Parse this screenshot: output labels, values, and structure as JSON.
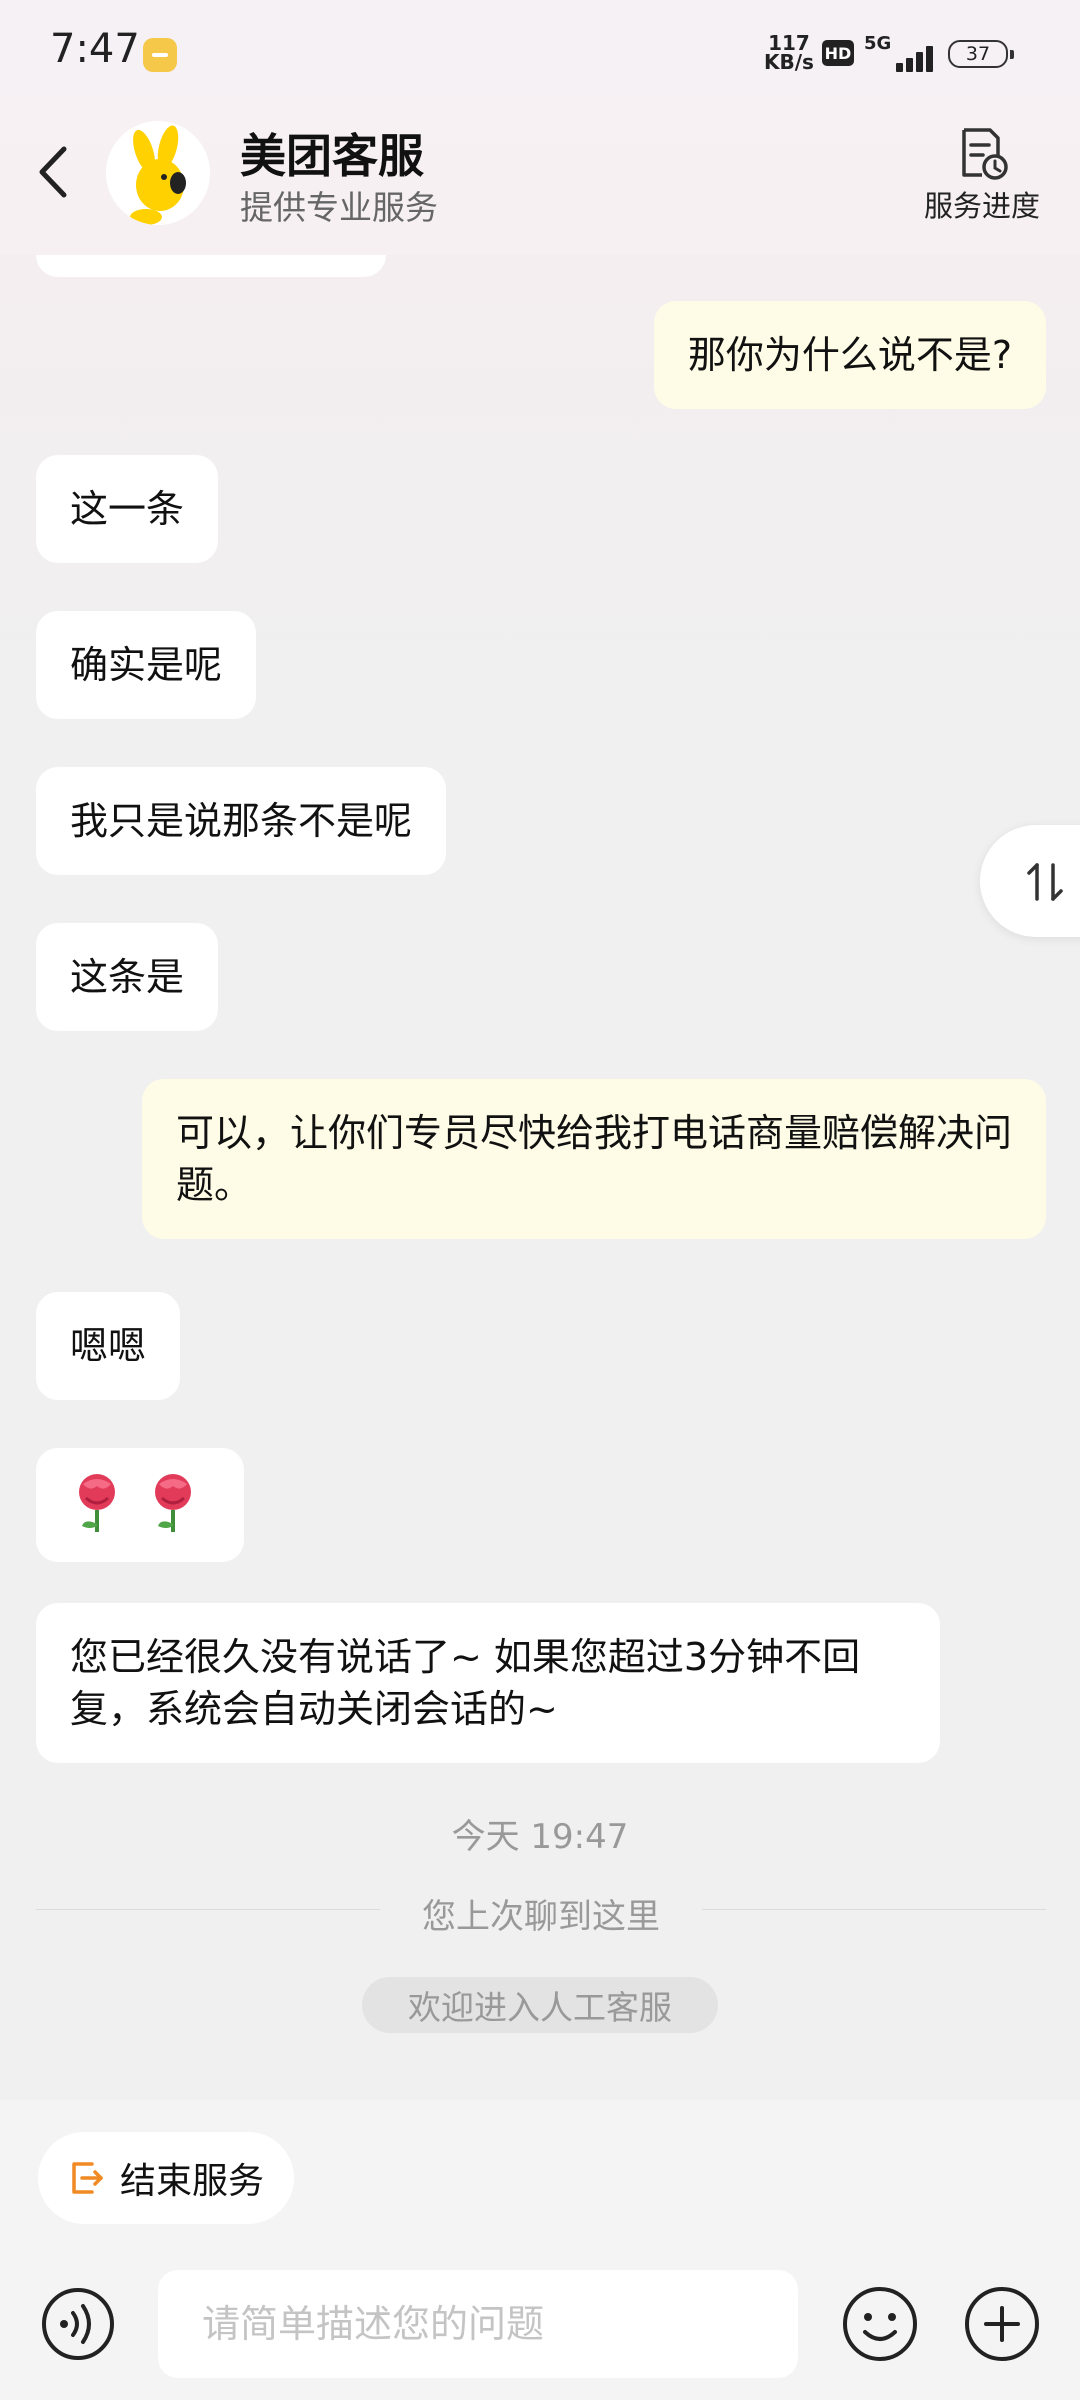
{
  "status_bar": {
    "time": "7:47",
    "net_speed_value": "117",
    "net_speed_unit": "KB/s",
    "hd": "HD",
    "network": "5G",
    "battery": "37"
  },
  "header": {
    "title": "美团客服",
    "subtitle": "提供专业服务",
    "progress_label": "服务进度"
  },
  "messages": [
    {
      "side": "right",
      "text": "那你为什么说不是?"
    },
    {
      "side": "left",
      "text": "这一条"
    },
    {
      "side": "left",
      "text": "确实是呢"
    },
    {
      "side": "left",
      "text": "我只是说那条不是呢"
    },
    {
      "side": "left",
      "text": "这条是"
    },
    {
      "side": "right",
      "text": "可以，让你们专员尽快给我打电话商量赔偿解决问题。"
    },
    {
      "side": "left",
      "text": "嗯嗯"
    },
    {
      "side": "left",
      "emoji": "rose-icons"
    },
    {
      "side": "left",
      "text": "您已经很久没有说话了~ 如果您超过3分钟不回复，系统会自动关闭会话的~"
    }
  ],
  "system": {
    "timestamp": "今天 19:47",
    "last_read": "您上次聊到这里",
    "welcome": "欢迎进入人工客服"
  },
  "bottom": {
    "end_service_label": "结束服务",
    "input_placeholder": "请简单描述您的问题"
  },
  "colors": {
    "user_bubble": "#fefce6",
    "agent_bubble": "#ffffff",
    "accent_orange": "#f08a24",
    "mascot_yellow": "#ffd100"
  }
}
